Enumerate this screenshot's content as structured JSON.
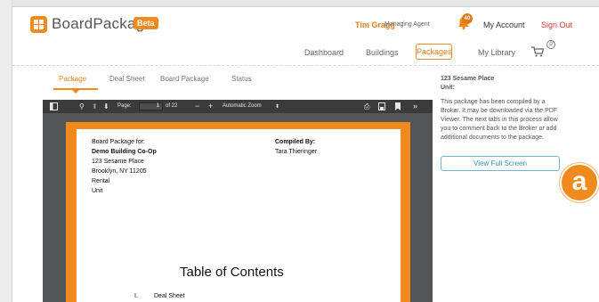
{
  "header": {
    "logo_text": "BoardPackager",
    "beta_badge": "Beta",
    "user_name": "Tim Gragg",
    "user_role": "Managing Agent",
    "notification_count": "40",
    "my_account": "My Account",
    "sign_out": "Sign Out",
    "brand_color": "#f08a1c"
  },
  "nav": {
    "items": [
      "Dashboard",
      "Buildings",
      "Packages",
      "My Library"
    ],
    "active": "Packages",
    "cart_count": "0"
  },
  "tabs": {
    "items": [
      "Package",
      "Deal Sheet",
      "Board Package",
      "Status"
    ],
    "active": "Package"
  },
  "viewer": {
    "page_label": "Page:",
    "page_value": "1",
    "page_total": "of 22",
    "zoom_value": "Automatic Zoom",
    "document": {
      "heading_left": "Board Package for:",
      "building_name": "Demo Building Co-Op",
      "address_lines": [
        "123 Sesame Place",
        "Brooklyn, NY 11205",
        "Rental",
        "Unit"
      ],
      "compiled_by_label": "Compiled By:",
      "compiled_by_name": "Tara Thieringer",
      "toc_title": "Table of Contents",
      "toc_first_item_number": "I.",
      "toc_first_item": "Deal Sheet"
    }
  },
  "right_panel": {
    "address": "123 Sesame Place",
    "unit_label": "Unit:",
    "description": "This package has been compiled by a Broker. It may be downloaded via the PDF Viewer. The next tabs in this process allow you to comment back to the Broker or add additional documents to the package.",
    "fullscreen_button": "View Full Screen"
  },
  "callout": {
    "label": "a"
  }
}
